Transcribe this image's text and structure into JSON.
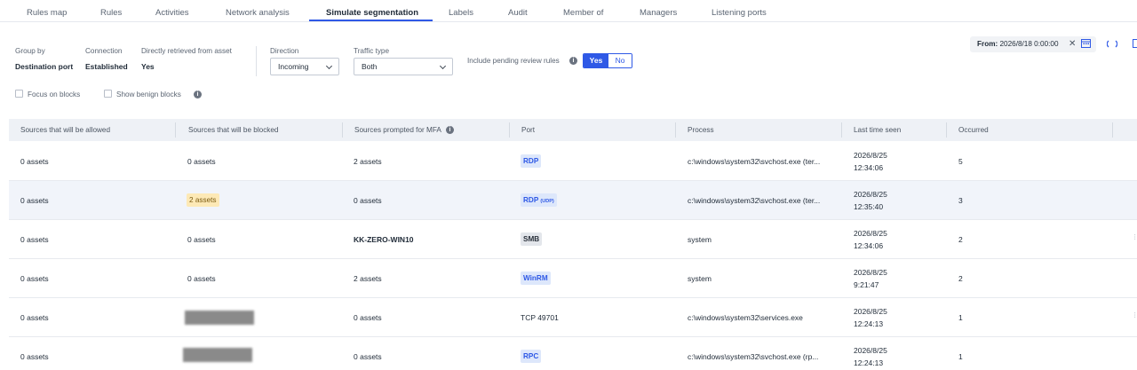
{
  "tabs": [
    {
      "label": "Rules map"
    },
    {
      "label": "Rules"
    },
    {
      "label": "Activities"
    },
    {
      "label": "Network analysis"
    },
    {
      "label": "Simulate segmentation",
      "active": true
    },
    {
      "label": "Labels"
    },
    {
      "label": "Audit"
    },
    {
      "label": "Member of"
    },
    {
      "label": "Managers"
    },
    {
      "label": "Listening ports"
    }
  ],
  "filters": {
    "group_by": {
      "label": "Group by",
      "value": "Destination port"
    },
    "connection": {
      "label": "Connection",
      "value": "Established"
    },
    "directly_retrieved": {
      "label": "Directly retrieved from asset",
      "value": "Yes"
    },
    "direction": {
      "label": "Direction",
      "value": "Incoming"
    },
    "traffic_type": {
      "label": "Traffic type",
      "value": "Both"
    },
    "pending": {
      "label": "Include pending review rules",
      "yes": "Yes",
      "no": "No",
      "selected": "Yes"
    },
    "focus_on_blocks": "Focus on blocks",
    "show_benign_blocks": "Show benign blocks"
  },
  "date_filter": {
    "prefix": "From:",
    "value": "2026/8/18 0:00:00"
  },
  "table": {
    "columns": [
      "Sources that will be allowed",
      "Sources that will be blocked",
      "Sources prompted for MFA",
      "Port",
      "Process",
      "Last time seen",
      "Occurred"
    ],
    "rows": [
      {
        "allowed": "0 assets",
        "blocked": "0 assets",
        "mfa": "2 assets",
        "port": "RDP",
        "port_sub": "",
        "port_style": "blue",
        "process": "c:\\windows\\system32\\svchost.exe (ter...",
        "date": "2026/8/25",
        "time": "12:34:06",
        "occurred": "5"
      },
      {
        "allowed": "0 assets",
        "blocked": "2 assets",
        "blocked_style": "yellow",
        "mfa": "0 assets",
        "port": "RDP",
        "port_sub": "(UDP)",
        "port_style": "blue",
        "process": "c:\\windows\\system32\\svchost.exe (ter...",
        "date": "2026/8/25",
        "time": "12:35:40",
        "occurred": "3"
      },
      {
        "allowed": "0 assets",
        "blocked": "0 assets",
        "mfa": "KK-ZERO-WIN10",
        "mfa_style": "bold",
        "port": "SMB",
        "port_sub": "",
        "port_style": "gray",
        "process": "system",
        "date": "2026/8/25",
        "time": "12:34:06",
        "occurred": "2"
      },
      {
        "allowed": "0 assets",
        "blocked": "0 assets",
        "mfa": "2 assets",
        "port": "WinRM",
        "port_sub": "",
        "port_style": "blue",
        "process": "system",
        "date": "2026/8/25",
        "time": "9:21:47",
        "occurred": "2"
      },
      {
        "allowed": "0 assets",
        "blocked": "",
        "blocked_style": "redacted",
        "mfa": "0 assets",
        "port": "TCP 49701",
        "port_sub": "",
        "port_style": "plain",
        "process": "c:\\windows\\system32\\services.exe",
        "date": "2026/8/25",
        "time": "12:24:13",
        "occurred": "1"
      },
      {
        "allowed": "0 assets",
        "blocked": "",
        "blocked_style": "redacted",
        "mfa": "0 assets",
        "port": "RPC",
        "port_sub": "",
        "port_style": "blue",
        "process": "c:\\windows\\system32\\svchost.exe (rp...",
        "date": "2026/8/25",
        "time": "12:24:13",
        "occurred": "1"
      }
    ]
  }
}
